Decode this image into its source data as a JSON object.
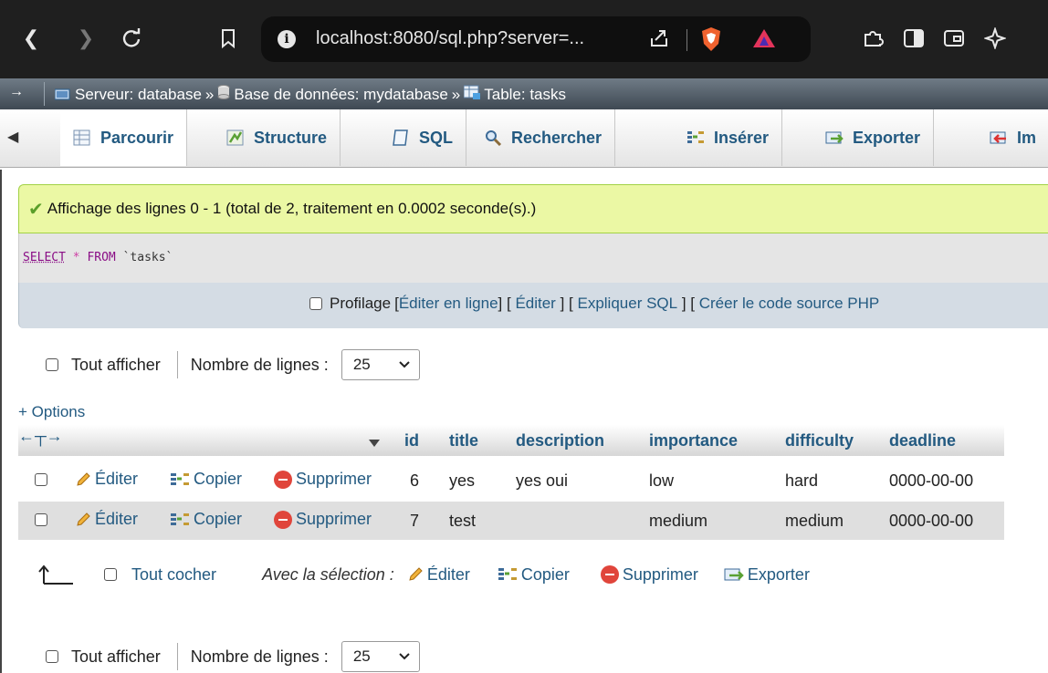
{
  "browser": {
    "url": "localhost:8080/sql.php?server=..."
  },
  "breadcrumb": {
    "server": "Serveur: database",
    "sep1": "»",
    "database": "Base de données: mydatabase",
    "sep2": "»",
    "table": "Table: tasks"
  },
  "tabs": [
    {
      "label": "Parcourir",
      "icon": "browse-icon"
    },
    {
      "label": "Structure",
      "icon": "structure-icon"
    },
    {
      "label": "SQL",
      "icon": "sql-icon"
    },
    {
      "label": "Rechercher",
      "icon": "search-icon"
    },
    {
      "label": "Insérer",
      "icon": "insert-icon"
    },
    {
      "label": "Exporter",
      "icon": "export-icon"
    },
    {
      "label": "Im",
      "icon": "import-icon"
    }
  ],
  "message": {
    "text": "Affichage des lignes 0 - 1 (total de 2, traitement en 0.0002 seconde(s).)"
  },
  "query": {
    "select": "SELECT",
    "star": "*",
    "from": "FROM",
    "table": "`tasks`"
  },
  "profile": {
    "label": "Profilage",
    "edit_inline": "Éditer en ligne",
    "edit": "Éditer",
    "explain": "Expliquer SQL",
    "create_php": "Créer le code source PHP"
  },
  "nav": {
    "show_all": "Tout afficher",
    "rows_label": "Nombre de lignes :",
    "rows_value": "25"
  },
  "options_link": "+ Options",
  "table": {
    "columns": [
      "id",
      "title",
      "description",
      "importance",
      "difficulty",
      "deadline"
    ],
    "actions": {
      "edit": "Éditer",
      "copy": "Copier",
      "delete": "Supprimer"
    },
    "rows": [
      {
        "id": "6",
        "title": "yes",
        "description": "yes oui",
        "importance": "low",
        "difficulty": "hard",
        "deadline": "0000-00-00"
      },
      {
        "id": "7",
        "title": "test",
        "description": "",
        "importance": "medium",
        "difficulty": "medium",
        "deadline": "0000-00-00"
      }
    ]
  },
  "bulk": {
    "check_all": "Tout cocher",
    "with_selection": "Avec la sélection :",
    "edit": "Éditer",
    "copy": "Copier",
    "delete": "Supprimer",
    "export": "Exporter"
  }
}
